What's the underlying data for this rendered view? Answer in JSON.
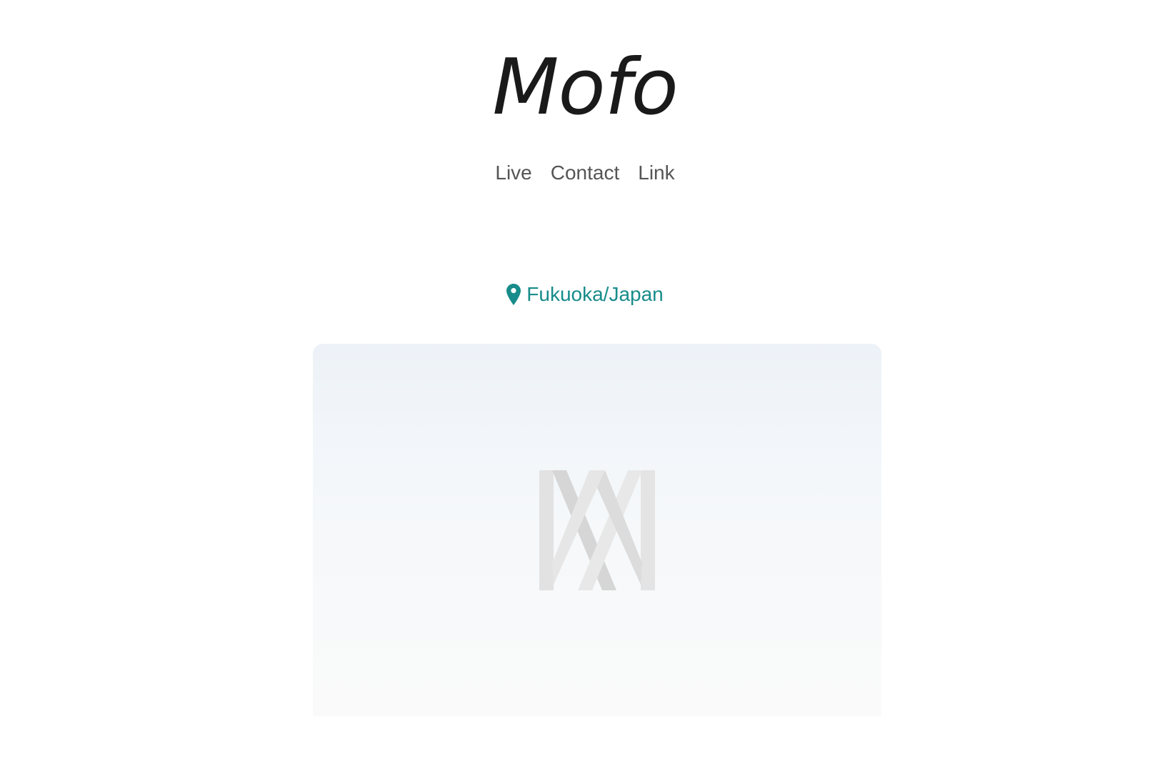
{
  "site": {
    "title": "Mofo"
  },
  "nav": {
    "items": [
      {
        "label": "Live"
      },
      {
        "label": "Contact"
      },
      {
        "label": "Link"
      }
    ]
  },
  "location": {
    "icon": "map-pin-icon",
    "label": "Fukuoka/Japan",
    "color": "#178c8a"
  },
  "hero": {
    "logo_icon": "mofo-logo-mark"
  }
}
